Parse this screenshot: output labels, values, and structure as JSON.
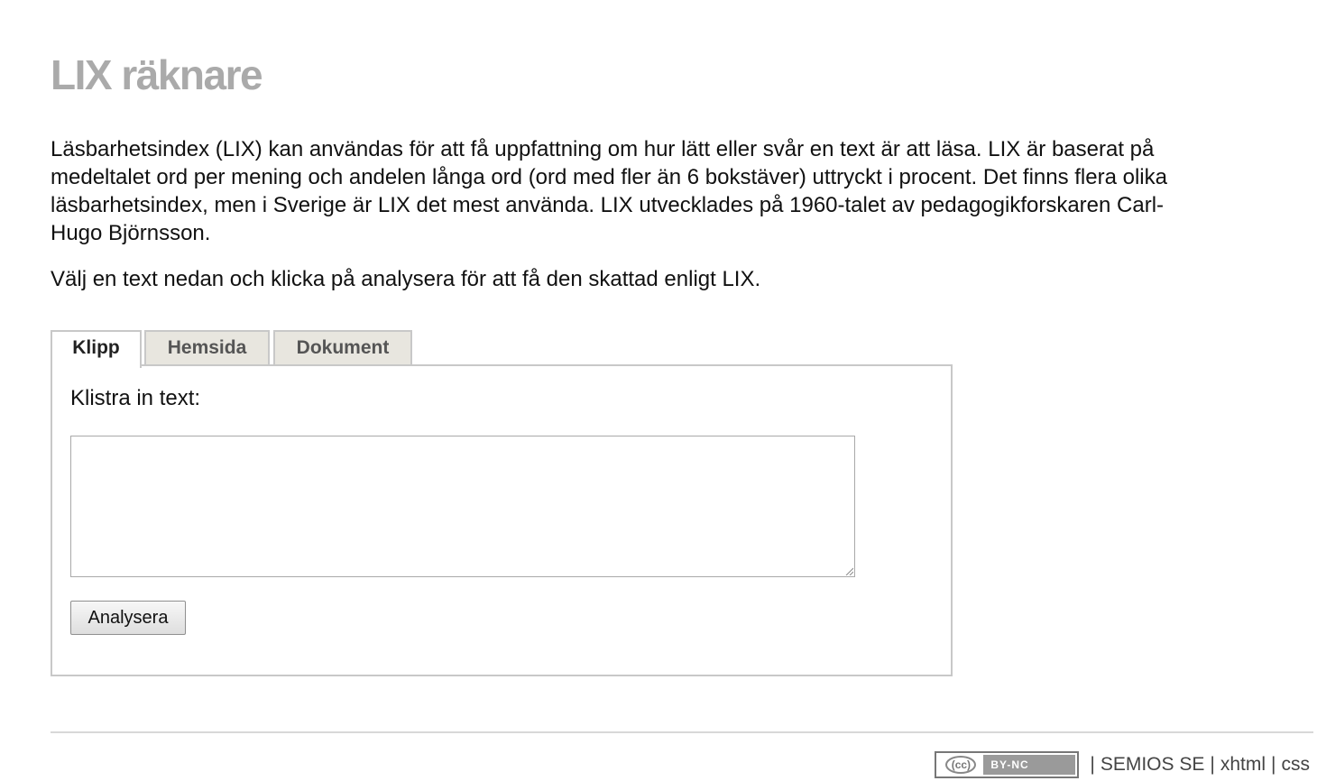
{
  "header": {
    "title": "LIX räknare"
  },
  "intro": {
    "paragraph": "Läsbarhetsindex (LIX) kan användas för att få uppfattning om hur lätt eller svår en text är att läsa. LIX är baserat på medeltalet ord per mening och andelen långa ord (ord med fler än 6 bokstäver) uttryckt i procent. Det finns flera olika läsbarhetsindex, men i Sverige är LIX det mest använda. LIX utvecklades på 1960-talet av pedagogikforskaren Carl-Hugo Björnsson.",
    "instruction": "Välj en text nedan och klicka på analysera för att få den skattad enligt LIX."
  },
  "tabs": [
    {
      "label": "Klipp",
      "active": true
    },
    {
      "label": "Hemsida",
      "active": false
    },
    {
      "label": "Dokument",
      "active": false
    }
  ],
  "panel": {
    "label": "Klistra in text:",
    "textarea_value": "",
    "button_label": "Analysera"
  },
  "footer": {
    "license_cc": "(cc)",
    "license_by": "BY-NC",
    "separator": "|",
    "site": "SEMIOS SE",
    "link_xhtml": "xhtml",
    "link_css": "css"
  },
  "colors": {
    "title": "#aaaaaa",
    "tab_inactive_bg": "#e8e6df",
    "border": "#c8c8c8"
  }
}
